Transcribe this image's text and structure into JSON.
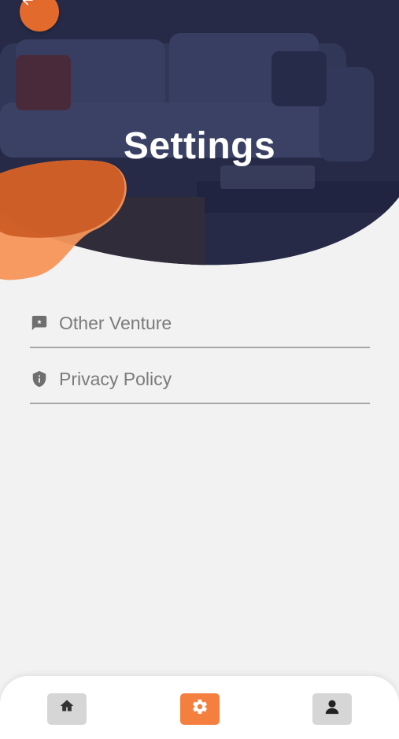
{
  "header": {
    "title": "Settings"
  },
  "menu": {
    "items": [
      {
        "label": "Other Venture",
        "icon": "feedback-star-icon"
      },
      {
        "label": "Privacy Policy",
        "icon": "shield-info-icon"
      }
    ]
  },
  "bottom_nav": {
    "items": [
      {
        "icon": "home-icon",
        "active": false
      },
      {
        "icon": "gear-icon",
        "active": true
      },
      {
        "icon": "person-icon",
        "active": false
      }
    ]
  },
  "colors": {
    "accent": "#f47f3f",
    "header_dark": "#272b48",
    "background": "#f2f2f2",
    "text_secondary": "#7b7b7b"
  }
}
